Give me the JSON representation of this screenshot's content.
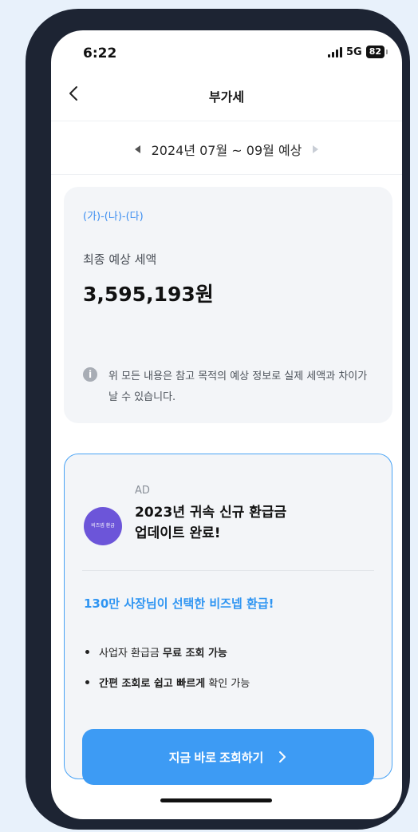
{
  "status_bar": {
    "time": "6:22",
    "network": "5G",
    "battery": "82"
  },
  "header": {
    "title": "부가세",
    "back_icon": "chevron-left-icon"
  },
  "period": {
    "label": "2024년 07월 ~ 09월 예상",
    "prev_icon": "triangle-left-icon",
    "next_icon": "triangle-right-icon"
  },
  "tax_card": {
    "formula": "(가)-(나)-(다)",
    "label": "최종 예상 세액",
    "amount": "3,595,193원",
    "notice": "위 모든 내용은 참고 목적의 예상 정보로 실제 세액과 차이가 날 수 있습니다.",
    "notice_icon": "info-icon"
  },
  "ad_card": {
    "tag": "AD",
    "logo_text": "비즈넵 환급",
    "title_line1": "2023년 귀속 신규 환급금",
    "title_line2": "업데이트 완료!",
    "subtitle": "130만 사장님이 선택한 비즈넵 환급!",
    "bullet1_normal": "사업자 환급금",
    "bullet1_bold": "무료 조회 가능",
    "bullet2_bold": "간편 조회로 쉽고 빠르게",
    "bullet2_normal": "확인 가능",
    "cta_label": "지금 바로 조회하기",
    "cta_icon": "chevron-right-icon",
    "colors": {
      "accent": "#3d9bf4",
      "logo_bg": "#6c55d9",
      "border": "#49a3f5"
    }
  }
}
